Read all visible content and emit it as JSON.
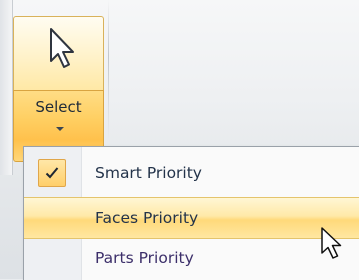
{
  "ribbon": {
    "select_button": {
      "label": "Select",
      "icon": "arrow-pointer-icon"
    }
  },
  "menu": {
    "items": [
      {
        "label": "Smart Priority",
        "checked": true,
        "highlighted": false
      },
      {
        "label": "Faces Priority",
        "checked": false,
        "highlighted": true
      },
      {
        "label": "Parts Priority",
        "checked": false,
        "highlighted": false
      }
    ]
  },
  "colors": {
    "hover_accent": "#ffd97a",
    "button_accent": "#ffc14c",
    "text": "#23334a"
  }
}
